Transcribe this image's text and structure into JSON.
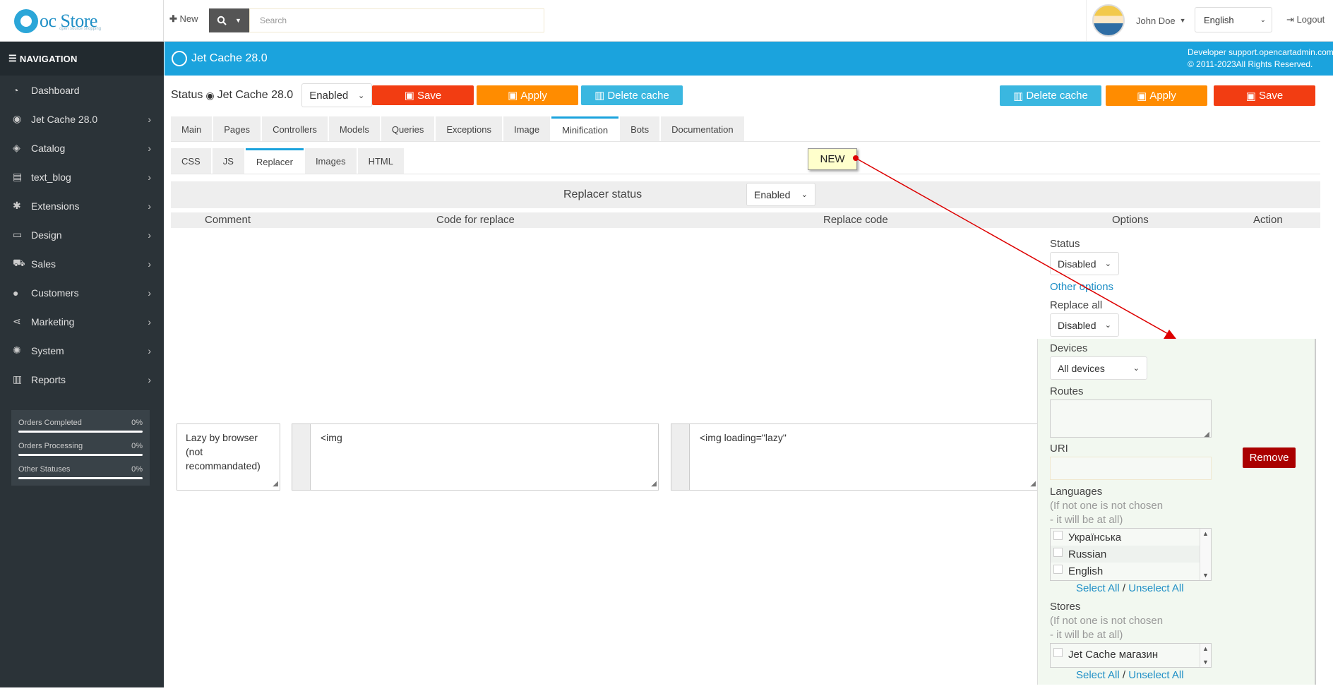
{
  "topbar": {
    "logo_text": "oc Store",
    "logo_sub": "open source shopping",
    "new_label": "New",
    "search_placeholder": "Search",
    "user_name": "John Doe",
    "language": "English",
    "logout_label": "Logout"
  },
  "sidebar": {
    "heading": "NAVIGATION",
    "items": [
      {
        "label": "Dashboard",
        "icon": "dashboard-icon"
      },
      {
        "label": "Jet Cache 28.0",
        "icon": "target-icon"
      },
      {
        "label": "Catalog",
        "icon": "tags-icon"
      },
      {
        "label": "text_blog",
        "icon": "book-icon"
      },
      {
        "label": "Extensions",
        "icon": "puzzle-icon"
      },
      {
        "label": "Design",
        "icon": "monitor-icon"
      },
      {
        "label": "Sales",
        "icon": "cart-icon"
      },
      {
        "label": "Customers",
        "icon": "user-icon"
      },
      {
        "label": "Marketing",
        "icon": "share-icon"
      },
      {
        "label": "System",
        "icon": "gear-icon"
      },
      {
        "label": "Reports",
        "icon": "bar-chart-icon"
      }
    ],
    "stats": [
      {
        "label": "Orders Completed",
        "pct": "0%"
      },
      {
        "label": "Orders Processing",
        "pct": "0%"
      },
      {
        "label": "Other Statuses",
        "pct": "0%"
      }
    ]
  },
  "header": {
    "title": "Jet Cache 28.0",
    "developer_line": "Developer support.opencartadmin.com",
    "copyright": "© 2011-2023All Rights Reserved."
  },
  "toolbar": {
    "status_label": "Status",
    "module_name": "Jet Cache 28.0",
    "status_value": "Enabled",
    "save": "Save",
    "apply": "Apply",
    "delete_cache": "Delete cache"
  },
  "tabs": [
    "Main",
    "Pages",
    "Controllers",
    "Models",
    "Queries",
    "Exceptions",
    "Image",
    "Minification",
    "Bots",
    "Documentation"
  ],
  "active_tab": "Minification",
  "subtabs": [
    "CSS",
    "JS",
    "Replacer",
    "Images",
    "HTML"
  ],
  "active_subtab": "Replacer",
  "new_badge": "NEW",
  "replacer": {
    "status_label": "Replacer status",
    "status_value": "Enabled",
    "columns": {
      "comment": "Comment",
      "code_for_replace": "Code for replace",
      "replace_code": "Replace code",
      "options": "Options",
      "action": "Action"
    },
    "row": {
      "comment": "Lazy by browser (not recommandated)",
      "code_for_replace": "<img",
      "replace_code": "<img loading=\"lazy\"",
      "remove": "Remove"
    }
  },
  "options": {
    "status_label": "Status",
    "status_value": "Disabled",
    "other_options": "Other options",
    "replace_all_label": "Replace all",
    "replace_all_value": "Disabled",
    "devices_label": "Devices",
    "devices_value": "All devices",
    "routes_label": "Routes",
    "uri_label": "URI",
    "languages_label": "Languages",
    "hint_line1": "(If not one is not chosen",
    "hint_line2": "- it will be at all)",
    "languages": [
      "Українська",
      "Russian",
      "English"
    ],
    "select_all": "Select All",
    "separator": "/",
    "unselect_all": "Unselect All",
    "stores_label": "Stores",
    "stores": [
      "Jet Cache магазин"
    ]
  }
}
